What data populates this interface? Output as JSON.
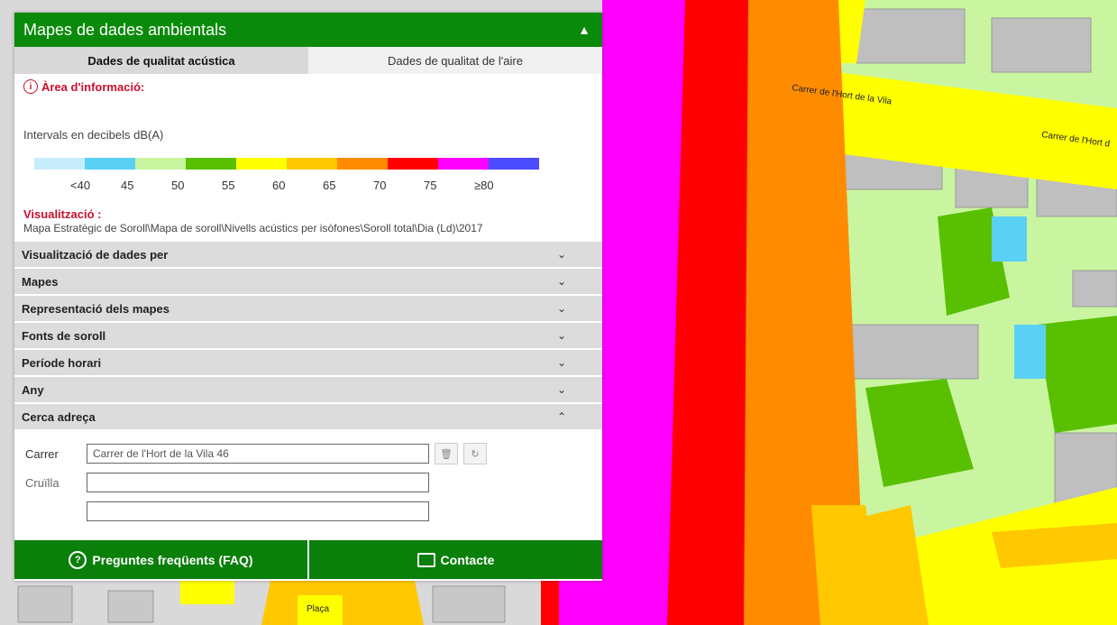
{
  "panel": {
    "title": "Mapes de dades ambientals",
    "collapse_icon": "chevron-up-icon",
    "tabs": [
      {
        "label": "Dades de qualitat acústica",
        "active": true
      },
      {
        "label": "Dades de qualitat de l'aire",
        "active": false
      }
    ],
    "info_label": "Àrea d'informació:",
    "intervals_label": "Intervals en decibels dB(A)",
    "scale": {
      "colors": [
        "#c7ecfb",
        "#5bd0f5",
        "#c9f5a0",
        "#58c000",
        "#ffff00",
        "#ffc800",
        "#ff8c00",
        "#ff0000",
        "#ff00ff",
        "#4b4bff"
      ],
      "labels": [
        "<40",
        "45",
        "50",
        "55",
        "60",
        "65",
        "70",
        "75",
        "≥80"
      ]
    },
    "visualization_label": "Visualització :",
    "visualization_path": "Mapa Estratègic de Soroll\\Mapa de soroll\\Nivells acústics per isòfones\\Soroll total\\Dia (Ld)\\2017"
  },
  "accordion": [
    {
      "label": "Visualització de dades per",
      "expanded": false
    },
    {
      "label": "Mapes",
      "expanded": false
    },
    {
      "label": "Representació dels mapes",
      "expanded": false
    },
    {
      "label": "Fonts de soroll",
      "expanded": false
    },
    {
      "label": "Període horari",
      "expanded": false
    },
    {
      "label": "Any",
      "expanded": false
    },
    {
      "label": "Cerca adreça",
      "expanded": true
    }
  ],
  "search": {
    "street_label": "Carrer",
    "street_value": "Carrer de l'Hort de la Vila 46",
    "crossing_label": "Cruïlla",
    "crossing_value": "",
    "extra_value": ""
  },
  "footer": {
    "faq_label": "Preguntes freqüents (FAQ)",
    "contact_label": "Contacte"
  },
  "map": {
    "street_labels": [
      "Carrer de l'Hort de la Vila",
      "Carrer de l'Hort d",
      "Plaça"
    ]
  }
}
